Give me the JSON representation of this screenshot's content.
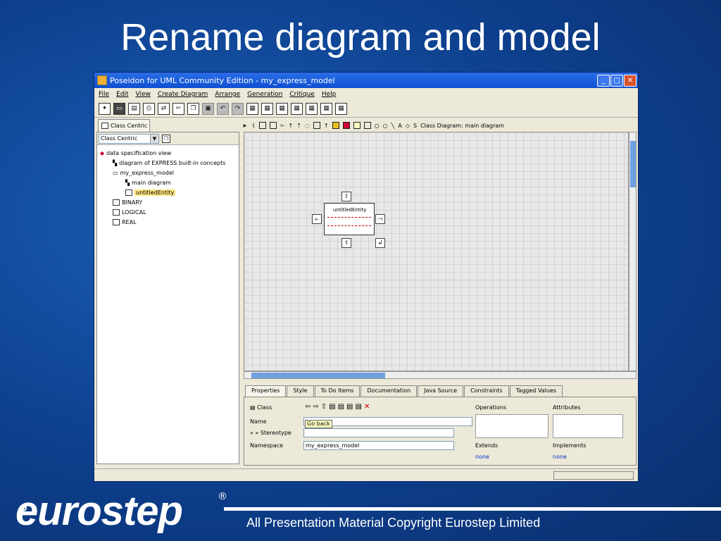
{
  "slide": {
    "title": "Rename diagram and model",
    "copyright": "All Presentation Material Copyright Eurostep Limited",
    "logo": "eurostep",
    "reg_mark": "®"
  },
  "window": {
    "title": "Poseidon for UML Community Edition - my_express_model",
    "menu": [
      "File",
      "Edit",
      "View",
      "Create Diagram",
      "Arrange",
      "Generation",
      "Critique",
      "Help"
    ],
    "diagram_label": "Class Diagram: main diagram"
  },
  "left": {
    "tab": "Class Centric",
    "combo": "Class Centric",
    "tree": [
      {
        "label": "data specification view",
        "indent": 0
      },
      {
        "label": "diagram of EXPRESS built-in concepts",
        "indent": 1
      },
      {
        "label": "my_express_model",
        "indent": 1
      },
      {
        "label": "main diagram",
        "indent": 2
      },
      {
        "label": "untitledEntity",
        "indent": 2,
        "selected": true
      },
      {
        "label": "BINARY",
        "indent": 1
      },
      {
        "label": "LOGICAL",
        "indent": 1
      },
      {
        "label": "REAL",
        "indent": 1
      }
    ]
  },
  "entity": {
    "name": "untitledEntity"
  },
  "props": {
    "tabs": [
      "Properties",
      "Style",
      "To Do Items",
      "Documentation",
      "Java Source",
      "Constraints",
      "Tagged Values"
    ],
    "class_label": "Class",
    "name_label": "Name",
    "tooltip": "Go back",
    "stereotype_label": "« » Stereotype",
    "namespace_label": "Namespace",
    "namespace_value": "my_express_model",
    "operations_label": "Operations",
    "attributes_label": "Attributes",
    "extends_label": "Extends",
    "implements_label": "Implements",
    "none1": "none",
    "none2": "none"
  }
}
